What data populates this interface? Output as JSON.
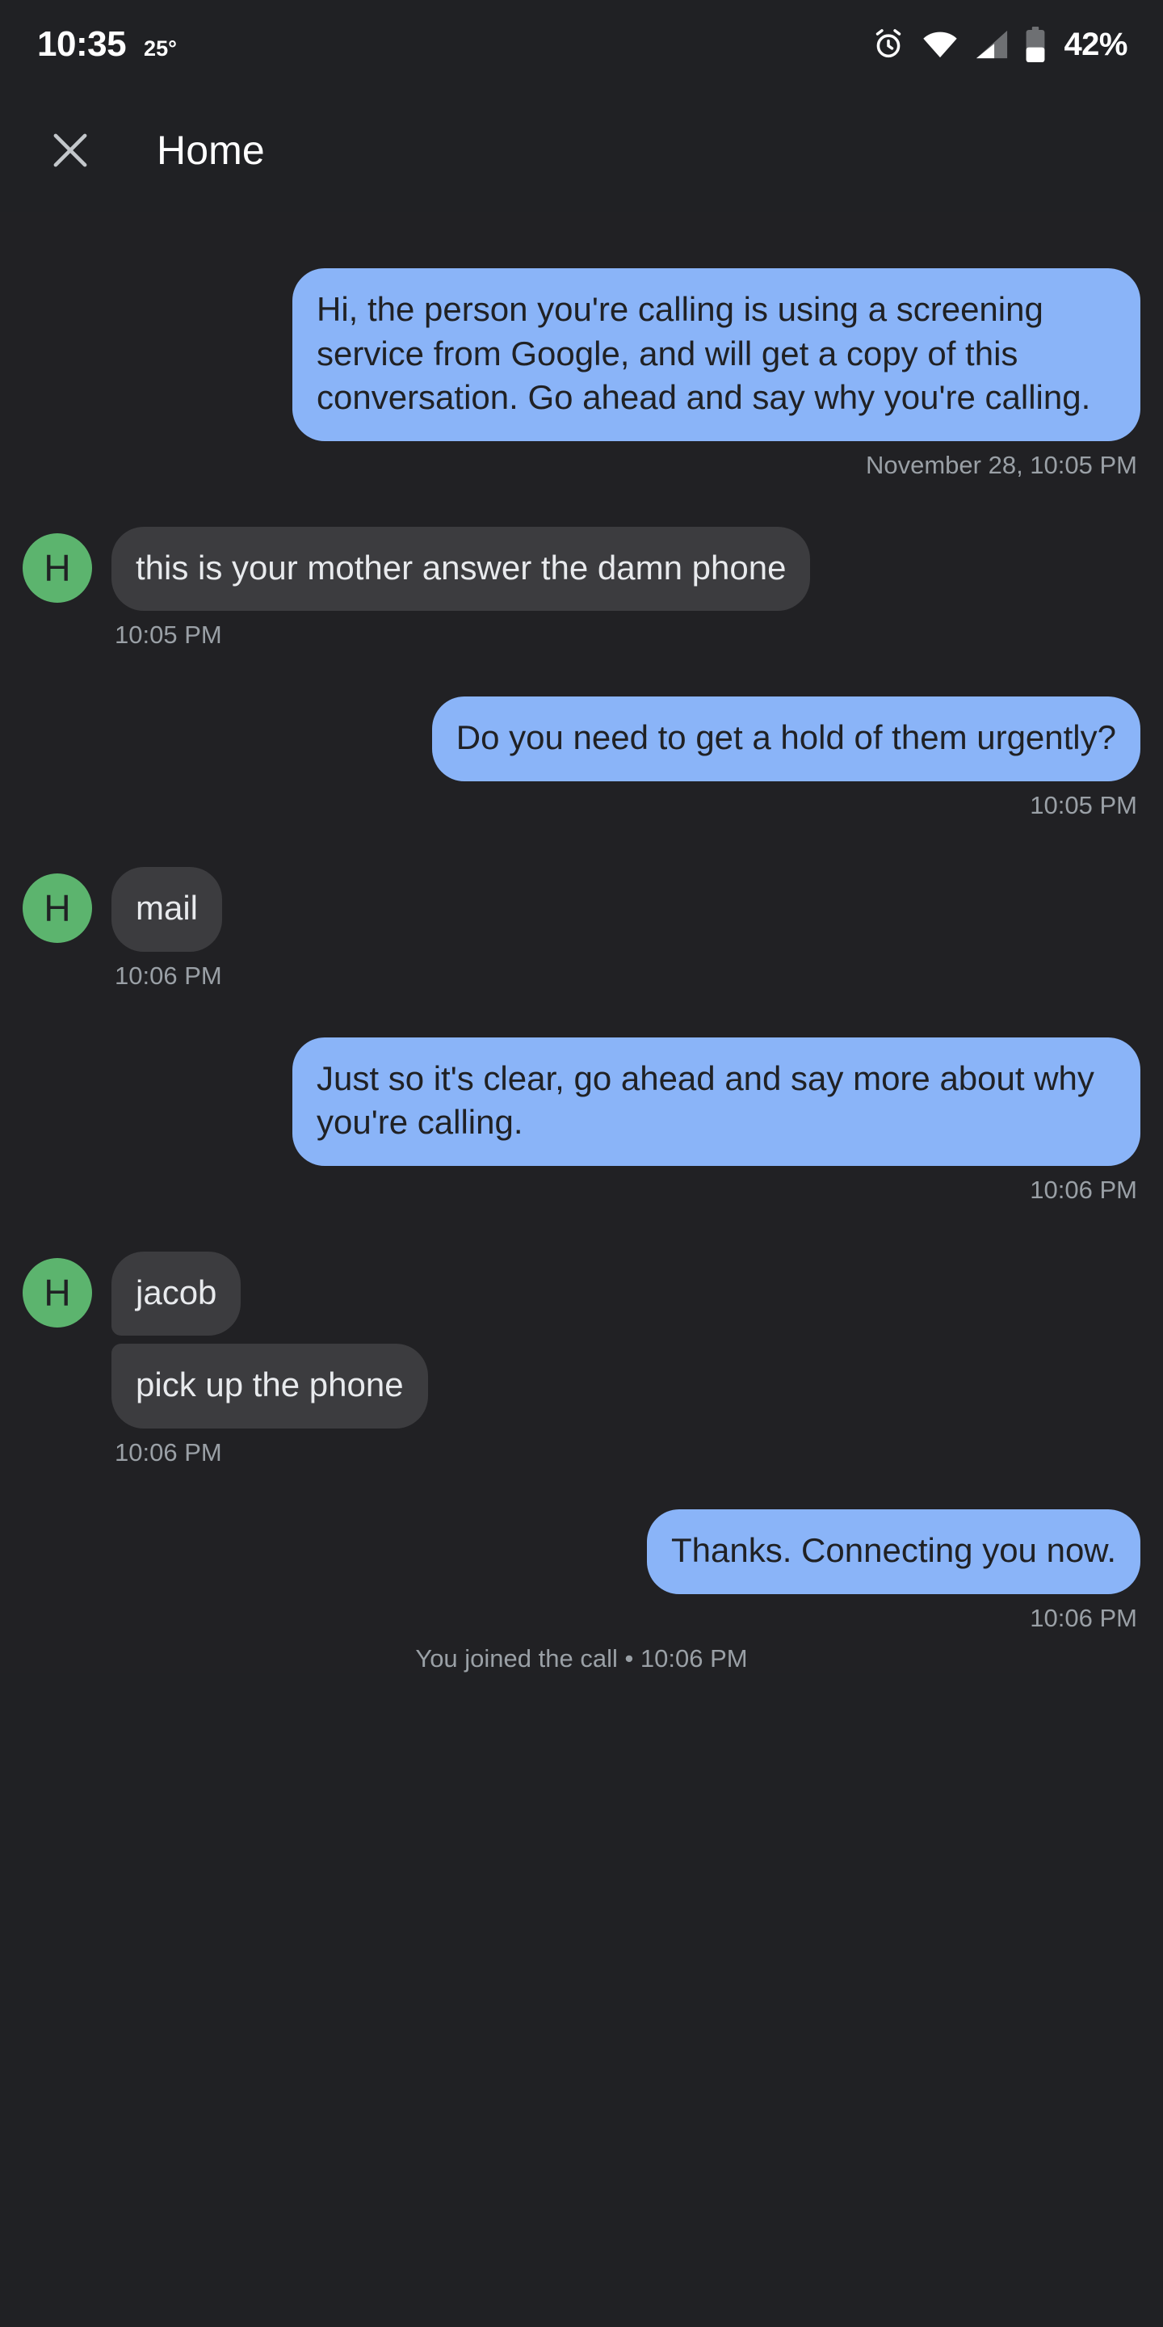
{
  "status_bar": {
    "time": "10:35",
    "temperature": "25°",
    "battery_percent": "42%",
    "icons": [
      "alarm-icon",
      "wifi-icon",
      "cellular-signal-icon",
      "battery-icon"
    ]
  },
  "app_bar": {
    "close_label": "close-icon",
    "title": "Home"
  },
  "colors": {
    "background": "#212124",
    "outgoing_bubble": "#8AB4F8",
    "incoming_bubble": "#3C3C3F",
    "avatar_green": "#5CB46E",
    "timestamp": "#9AA0A6",
    "title_text": "#FFFFFF"
  },
  "avatar": {
    "initial": "H"
  },
  "messages": [
    {
      "id": "m1",
      "side": "outgoing",
      "text": "Hi, the person you're calling is using a screening service from Google, and will get a copy of this conversation. Go ahead and say why you're calling.",
      "timestamp": "November 28, 10:05 PM"
    },
    {
      "id": "m2",
      "side": "incoming",
      "text": "this is your mother answer the damn phone",
      "timestamp": "10:05 PM"
    },
    {
      "id": "m3",
      "side": "outgoing",
      "text": "Do you need to get a hold of them urgently?",
      "timestamp": "10:05 PM"
    },
    {
      "id": "m4",
      "side": "incoming",
      "text": "mail",
      "timestamp": "10:06 PM"
    },
    {
      "id": "m5",
      "side": "outgoing",
      "text": "Just so it's clear, go ahead and say more about why you're calling.",
      "timestamp": "10:06 PM"
    },
    {
      "id": "m6a",
      "side": "incoming",
      "text": "jacob",
      "timestamp": ""
    },
    {
      "id": "m6b",
      "side": "incoming",
      "text": "pick up the phone",
      "timestamp": "10:06 PM"
    },
    {
      "id": "m7",
      "side": "outgoing",
      "text": "Thanks. Connecting you now.",
      "timestamp": "10:06 PM"
    }
  ],
  "system_note": "You joined the call • 10:06 PM"
}
